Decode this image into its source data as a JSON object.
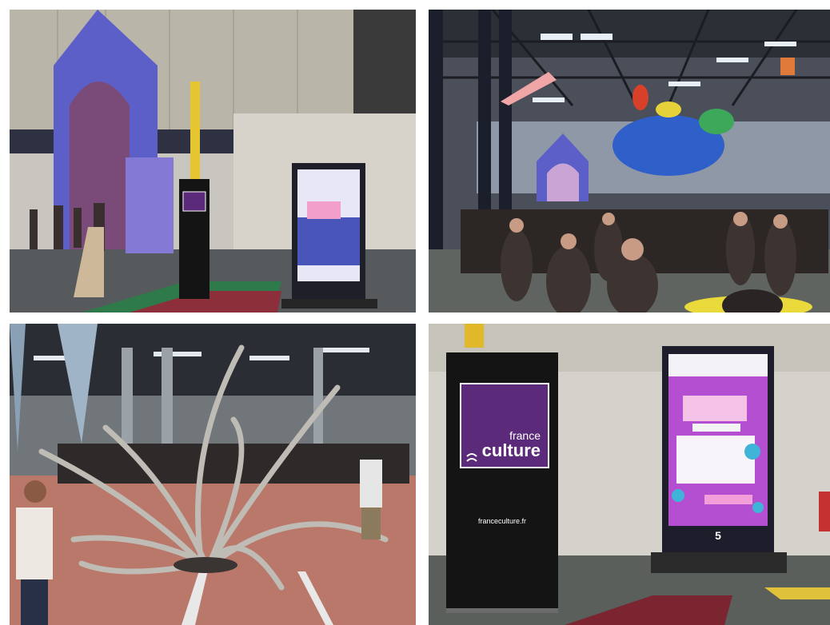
{
  "collage": {
    "layout": "2x2 grid",
    "photos": [
      {
        "id": "top-left",
        "subject": "warehouse entrance with purple arch, banner and digital poster"
      },
      {
        "id": "top-right",
        "subject": "crowd inside warehouse with colorful suspended sculptures"
      },
      {
        "id": "bottom-left",
        "subject": "twisted metal branch sculpture on red floor"
      },
      {
        "id": "bottom-right",
        "subject": "France Culture roll-up banner and digital display"
      }
    ]
  },
  "banner": {
    "brand_line1": "france",
    "brand_line2": "culture",
    "url": "franceculture.fr"
  },
  "colors": {
    "brand_purple": "#5b2a7a",
    "banner_black": "#141414",
    "floor_red": "#b9786a",
    "arch_blue": "#5d5fc9",
    "screen_pink": "#d94fd6"
  }
}
